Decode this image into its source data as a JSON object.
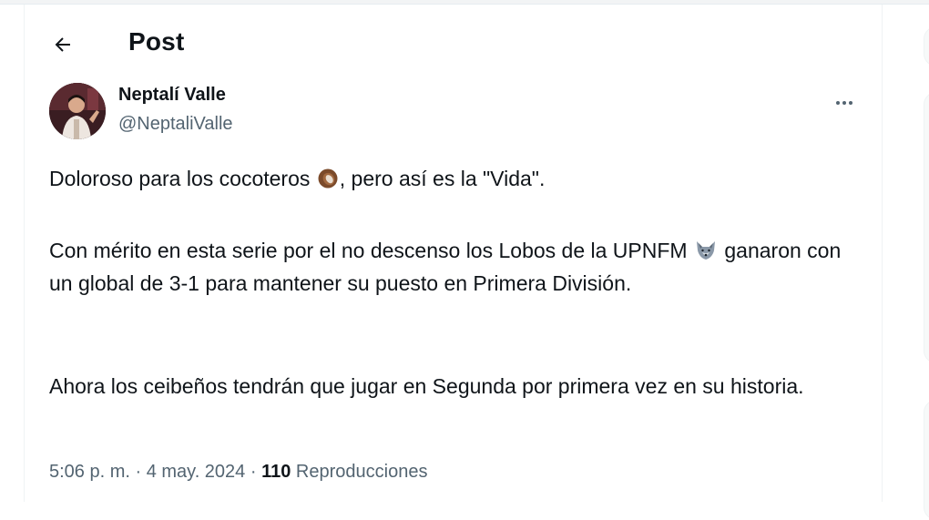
{
  "header": {
    "title": "Post",
    "back_icon": "arrow-left-icon"
  },
  "author": {
    "name": "Neptalí Valle",
    "handle": "@NeptaliValle",
    "more_icon": "more-horizontal-icon"
  },
  "post": {
    "p1_before": "Doloroso para los cocoteros",
    "p1_emoji": "coconut-icon",
    "p1_after": ", pero así es la \"Vida\".",
    "p2_before": "Con mérito en esta serie por el no descenso los Lobos de la UPNFM",
    "p2_emoji": "wolf-icon",
    "p2_after": "ganaron con un global de 3-1 para mantener su puesto en Primera División.",
    "p3": "Ahora los ceibeños tendrán que jugar en Segunda por primera vez en su historia."
  },
  "meta": {
    "time": "5:06 p. m.",
    "sep1": " · ",
    "date": "4 may. 2024",
    "sep2": " · ",
    "views_count": "110",
    "views_label": " Reproducciones"
  },
  "colors": {
    "text_primary": "#0f1419",
    "text_secondary": "#536471",
    "border": "#eff3f4"
  }
}
